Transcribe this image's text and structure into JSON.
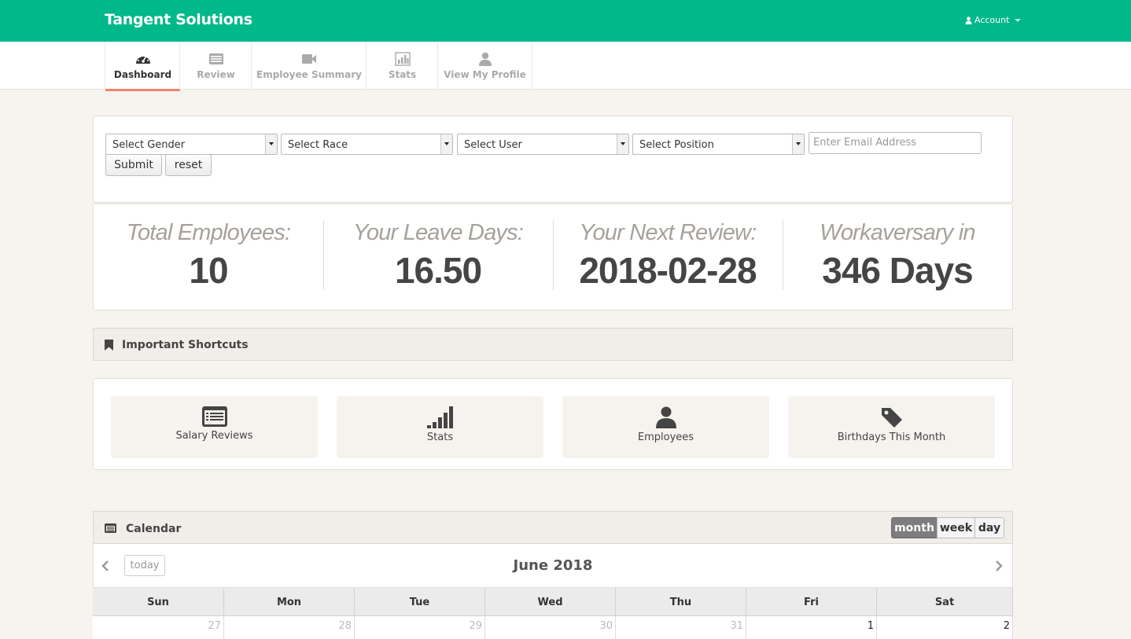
{
  "app": {
    "brand": "Tangent Solutions",
    "account_label": "Account"
  },
  "nav": {
    "tabs": [
      {
        "label": "Dashboard",
        "icon": "dashboard-icon",
        "active": true
      },
      {
        "label": "Review",
        "icon": "list-icon"
      },
      {
        "label": "Employee Summary",
        "icon": "video-camera-icon"
      },
      {
        "label": "Stats",
        "icon": "bar-chart-icon"
      },
      {
        "label": "View My Profile",
        "icon": "user-icon"
      }
    ]
  },
  "filters": {
    "gender": "Select Gender",
    "race": "Select Race",
    "user": "Select User",
    "position": "Select Position",
    "email_placeholder": "Enter Email Address",
    "submit": "Submit",
    "reset": "reset"
  },
  "stats": [
    {
      "label": "Total Employees:",
      "value": "10"
    },
    {
      "label": "Your Leave Days:",
      "value": "16.50"
    },
    {
      "label": "Your Next Review:",
      "value": "2018-02-28"
    },
    {
      "label": "Workaversary in",
      "value": "346 Days"
    }
  ],
  "shortcuts": {
    "title": "Important Shortcuts",
    "items": [
      {
        "label": "Salary Reviews",
        "icon": "list-alt-icon"
      },
      {
        "label": "Stats",
        "icon": "signal-icon"
      },
      {
        "label": "Employees",
        "icon": "user-icon"
      },
      {
        "label": "Birthdays This Month",
        "icon": "tag-icon"
      }
    ]
  },
  "calendar": {
    "title": "Calendar",
    "views": [
      "month",
      "week",
      "day"
    ],
    "active_view": "month",
    "today_label": "today",
    "month_title": "June 2018",
    "weekdays": [
      "Sun",
      "Mon",
      "Tue",
      "Wed",
      "Thu",
      "Fri",
      "Sat"
    ],
    "first_row": [
      "27",
      "28",
      "29",
      "30",
      "31",
      "1",
      "2"
    ]
  },
  "colors": {
    "brand_green": "#00b88a",
    "active_tab_underline": "#f0826c"
  }
}
